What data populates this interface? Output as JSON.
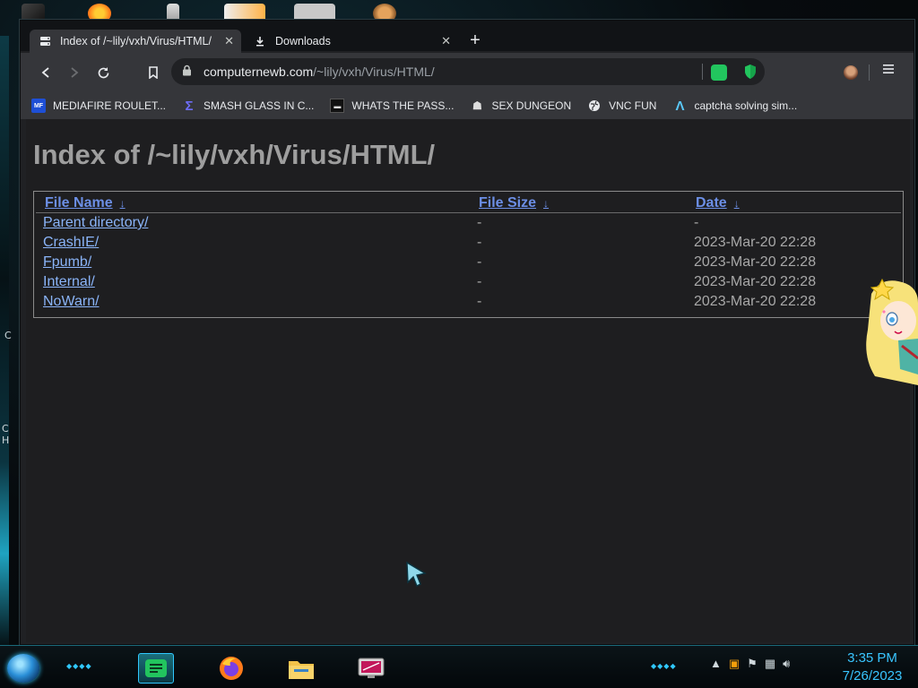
{
  "browser": {
    "tabs": [
      {
        "title": "Index of /~lily/vxh/Virus/HTML/",
        "active": true,
        "icon": "server-icon"
      },
      {
        "title": "Downloads",
        "active": false,
        "icon": "download-icon"
      }
    ],
    "address": {
      "domain": "computernewb.com",
      "path": "/~lily/vxh/Virus/HTML/"
    },
    "bookmarks": [
      {
        "label": "MEDIAFIRE ROULET...",
        "icon": "mediafire-icon"
      },
      {
        "label": "SMASH GLASS IN C...",
        "icon": "sigma-icon"
      },
      {
        "label": "WHATS THE PASS...",
        "icon": "terminal-icon"
      },
      {
        "label": "SEX DUNGEON",
        "icon": "robot-icon"
      },
      {
        "label": "VNC FUN",
        "icon": "globe-icon"
      },
      {
        "label": "captcha solving sim...",
        "icon": "lambda-icon"
      }
    ]
  },
  "page": {
    "title": "Index of /~lily/vxh/Virus/HTML/",
    "columns": {
      "name": "File Name",
      "size": "File Size",
      "date": "Date",
      "sort_glyph": "↓"
    },
    "rows": [
      {
        "name": "Parent directory/",
        "size": "-",
        "date": "-"
      },
      {
        "name": "CrashIE/",
        "size": "-",
        "date": "2023-Mar-20 22:28"
      },
      {
        "name": "Fpumb/",
        "size": "-",
        "date": "2023-Mar-20 22:28"
      },
      {
        "name": "Internal/",
        "size": "-",
        "date": "2023-Mar-20 22:28"
      },
      {
        "name": "NoWarn/",
        "size": "-",
        "date": "2023-Mar-20 22:28"
      }
    ]
  },
  "taskbar": {
    "apps": [
      "notes-app-icon",
      "firefox-icon",
      "file-explorer-icon",
      "monitor-app-icon"
    ],
    "clock": {
      "time": "3:35 PM",
      "date": "7/26/2023"
    }
  },
  "colors": {
    "link": "#8ab4f8",
    "header_link": "#6c8fe6",
    "title": "#9e9e9e",
    "clock": "#39c5ff"
  }
}
